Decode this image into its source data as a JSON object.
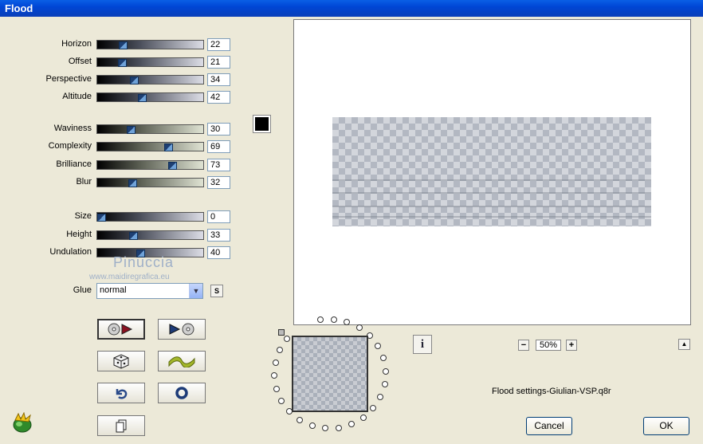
{
  "window": {
    "title": "Flood"
  },
  "sliders": {
    "group1": [
      {
        "label": "Horizon",
        "value": "22",
        "level": 22
      },
      {
        "label": "Offset",
        "value": "21",
        "level": 21
      },
      {
        "label": "Perspective",
        "value": "34",
        "level": 34
      },
      {
        "label": "Altitude",
        "value": "42",
        "level": 42
      }
    ],
    "group2": [
      {
        "label": "Waviness",
        "value": "30",
        "level": 30
      },
      {
        "label": "Complexity",
        "value": "69",
        "level": 69
      },
      {
        "label": "Brilliance",
        "value": "73",
        "level": 73
      },
      {
        "label": "Blur",
        "value": "32",
        "level": 32
      }
    ],
    "group3": [
      {
        "label": "Size",
        "value": "0",
        "level": 0
      },
      {
        "label": "Height",
        "value": "33",
        "level": 33
      },
      {
        "label": "Undulation",
        "value": "40",
        "level": 40
      }
    ]
  },
  "color_swatch": "#000000",
  "watermark": {
    "name": "Pinuccia",
    "url": "www.maidiregrafica.eu"
  },
  "glue": {
    "label": "Glue",
    "value": "normal"
  },
  "s_button": "S",
  "tool_buttons": {
    "apply_icon": "disc-play-icon",
    "next_icon": "play-disc-icon",
    "random_icon": "dice-icon",
    "wave_icon": "wave-icon",
    "undo_icon": "undo-arrow-icon",
    "reset_icon": "circle-icon",
    "copy_icon": "copy-page-icon"
  },
  "zoom": {
    "minus": "−",
    "value": "50%",
    "plus": "+"
  },
  "info_button": "i",
  "up_button": "▲",
  "settings_file": "Flood settings-Giulian-VSP.q8r",
  "buttons": {
    "cancel": "Cancel",
    "ok": "OK"
  }
}
